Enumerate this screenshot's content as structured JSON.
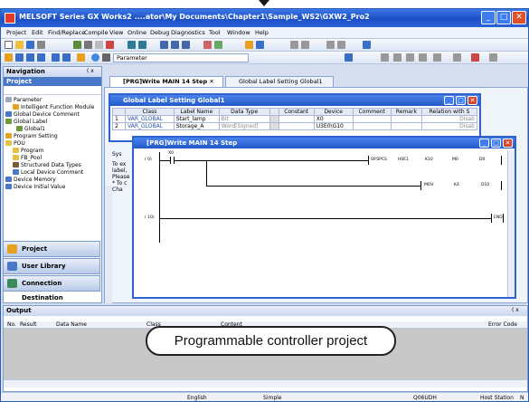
{
  "window": {
    "title": "MELSOFT Series GX Works2 ....ator\\My Documents\\Chapter1\\Sample_WS2\\GXW2_Pro2"
  },
  "menu": [
    "Project",
    "Edit",
    "Find/Replace",
    "Compile",
    "View",
    "Online",
    "Debug",
    "Diagnostics",
    "Tool",
    "Window",
    "Help"
  ],
  "toolbar": {
    "dropdown_value": "Parameter"
  },
  "navigation": {
    "title": "Navigation",
    "pin": "( x",
    "section": "Project",
    "tree": [
      "Parameter",
      "Intelligent Function Module",
      "Global Device Comment",
      "Global Label",
      "Global1",
      "Program Setting",
      "POU",
      "Program",
      "FB_Pool",
      "Structured Data Types",
      "Local Device Comment",
      "Device Memory",
      "Device Initial Value"
    ],
    "buttons": [
      "Project",
      "User Library",
      "Connection Destination"
    ]
  },
  "tabs": [
    "[PRG]Write MAIN 14 Step",
    "Global Label Setting Global1"
  ],
  "global_label_window": {
    "title": "Global Label Setting Global1",
    "columns": [
      "Class",
      "Label Name",
      "Data Type",
      "Constant",
      "Device",
      "Comment",
      "Remark",
      "Relation with S"
    ],
    "rows": [
      {
        "no": "1",
        "class": "VAR_GLOBAL",
        "label": "Start_lamp",
        "type": "Bit",
        "device": "X0",
        "relation": "Disab"
      },
      {
        "no": "2",
        "class": "VAR_GLOBAL",
        "label": "Storage_A",
        "type": "Word[Signed]",
        "device": "U3E0\\G10",
        "relation": "Disab"
      }
    ]
  },
  "ladder_window": {
    "title": "[PRG]Write MAIN 14 Step",
    "rungs": [
      {
        "step": "( 0)",
        "contact": "X0",
        "instr": "SP.SPCS",
        "ops": [
          "H0E1",
          "K10",
          "M0",
          "D0"
        ]
      },
      {
        "step": "",
        "instr": "MOV",
        "ops": [
          "K4",
          "D10"
        ]
      },
      {
        "step": "( 10)",
        "instr": "END"
      }
    ]
  },
  "side_text": {
    "label": "Sys",
    "lines": [
      "To ex",
      "label,",
      "Please",
      "* To c",
      "Cha"
    ]
  },
  "output": {
    "title": "Output",
    "pin": "( x",
    "columns": [
      "No.",
      "Result",
      "Data Name",
      "Class",
      "Content",
      "Error Code"
    ]
  },
  "status": {
    "lang": "English",
    "mode": "Simple",
    "cpu": "Q06UDH",
    "station": "Host Station",
    "num": "N"
  },
  "callout": "Programmable controller project",
  "colors": {
    "title": "#1c4fc4",
    "accent": "#4a78c8"
  }
}
